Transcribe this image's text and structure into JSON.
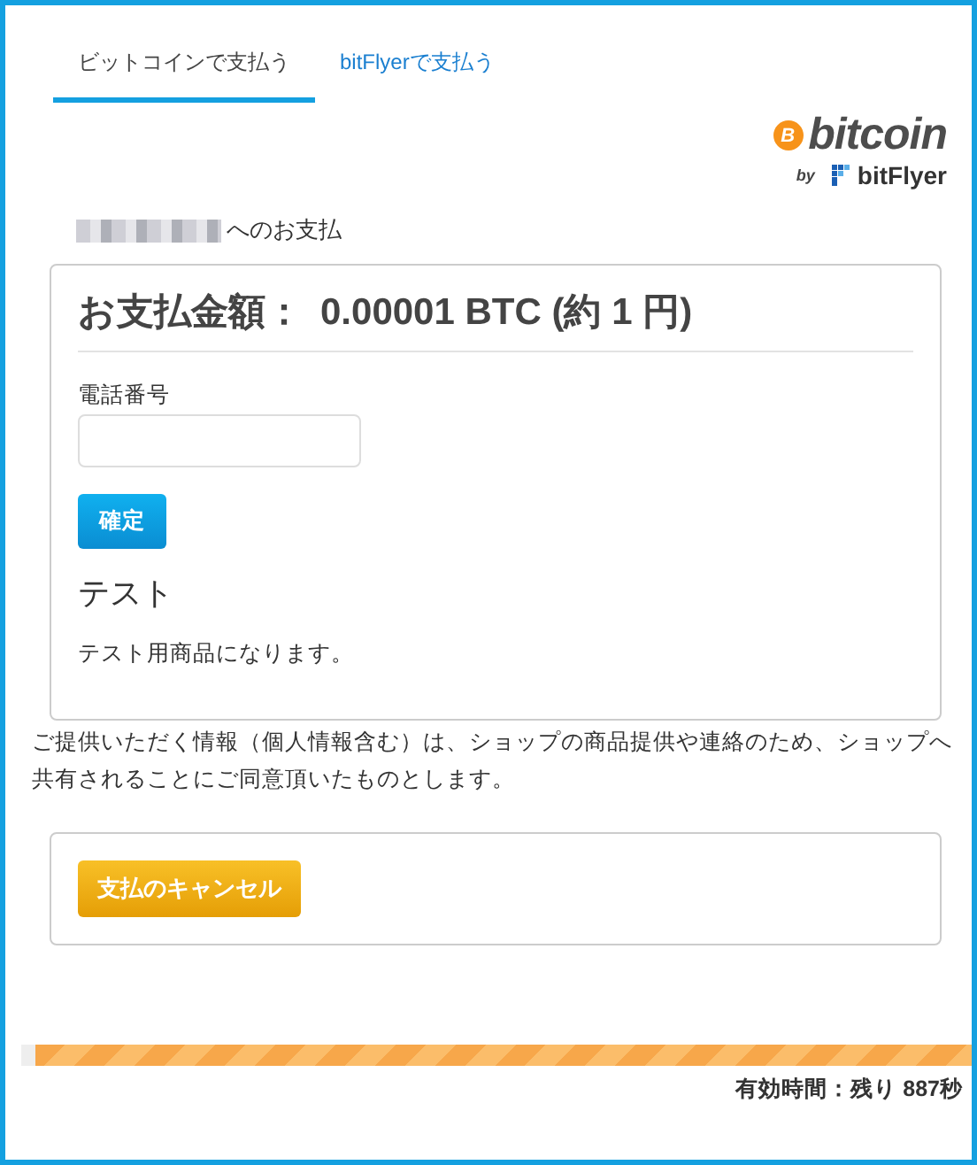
{
  "tabs": [
    {
      "label": "ビットコインで支払う",
      "selected": true
    },
    {
      "label": "bitFlyerで支払う",
      "selected": false
    }
  ],
  "logo": {
    "mark": "B",
    "name": "bitcoin",
    "by": "by",
    "brand": "bitFlyer"
  },
  "payee": {
    "suffix": "へのお支払"
  },
  "amount": {
    "label": "お支払金額：",
    "value": "0.00001 BTC (約 1 円)"
  },
  "phone": {
    "label": "電話番号"
  },
  "confirm_button": "確定",
  "product": {
    "title": "テスト",
    "description": "テスト用商品になります。"
  },
  "consent": "ご提供いただく情報（個人情報含む）は、ショップの商品提供や連絡のため、ショップへ共有されることにご同意頂いたものとします。",
  "cancel_button": "支払のキャンセル",
  "timer": {
    "level": 0.985,
    "label": "有効時間：残り 887秒"
  }
}
